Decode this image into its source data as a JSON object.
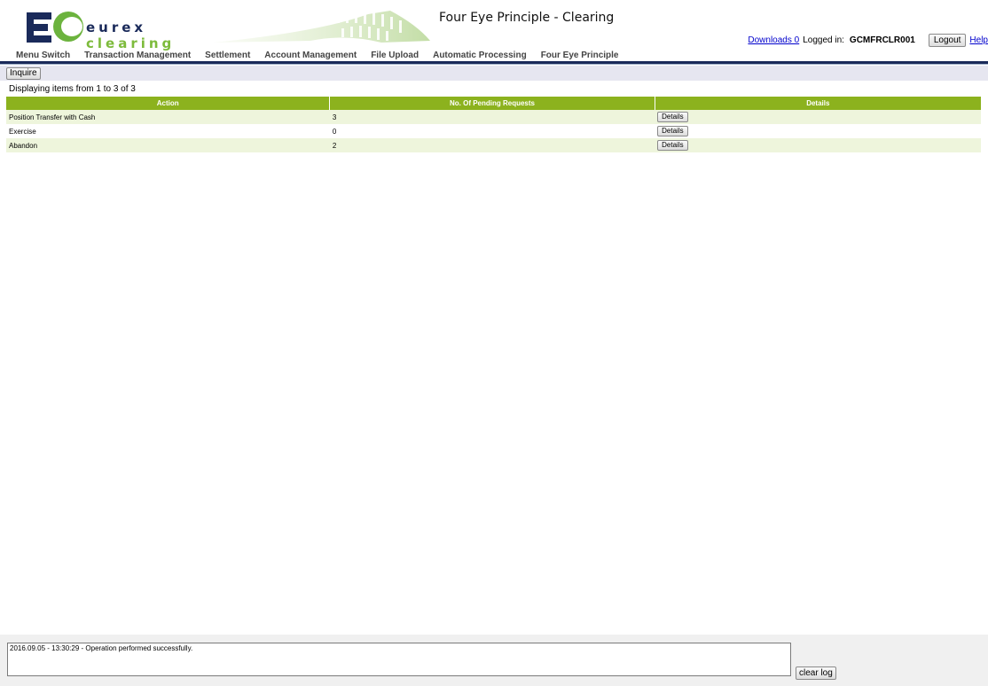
{
  "header": {
    "logo": {
      "word1": "eurex",
      "word2": "clearing"
    },
    "title": "Four Eye Principle - Clearing",
    "downloads_link": "Downloads 0",
    "logged_in_label": "Logged in:",
    "user_id": "GCMFRCLR001",
    "logout_label": "Logout",
    "help_link": "Help"
  },
  "menu": [
    "Menu Switch",
    "Transaction Management",
    "Settlement",
    "Account Management",
    "File Upload",
    "Automatic Processing",
    "Four Eye Principle"
  ],
  "toolbar": {
    "inquire_label": "Inquire"
  },
  "displaying_text": "Displaying items from 1 to 3 of 3",
  "table": {
    "columns": [
      "Action",
      "No. Of Pending Requests",
      "Details"
    ],
    "rows": [
      {
        "action": "Position Transfer with Cash",
        "pending": "3",
        "details_label": "Details"
      },
      {
        "action": "Exercise",
        "pending": "0",
        "details_label": "Details"
      },
      {
        "action": "Abandon",
        "pending": "2",
        "details_label": "Details"
      }
    ]
  },
  "footer": {
    "log_text": "2016.09.05 - 13:30:29 - Operation performed successfully.",
    "clear_log_label": "clear log"
  },
  "colors": {
    "brand_navy": "#1a2a5a",
    "brand_green": "#7dbb3c",
    "table_header": "#8cb21e",
    "row_alt": "#eef5dc"
  }
}
